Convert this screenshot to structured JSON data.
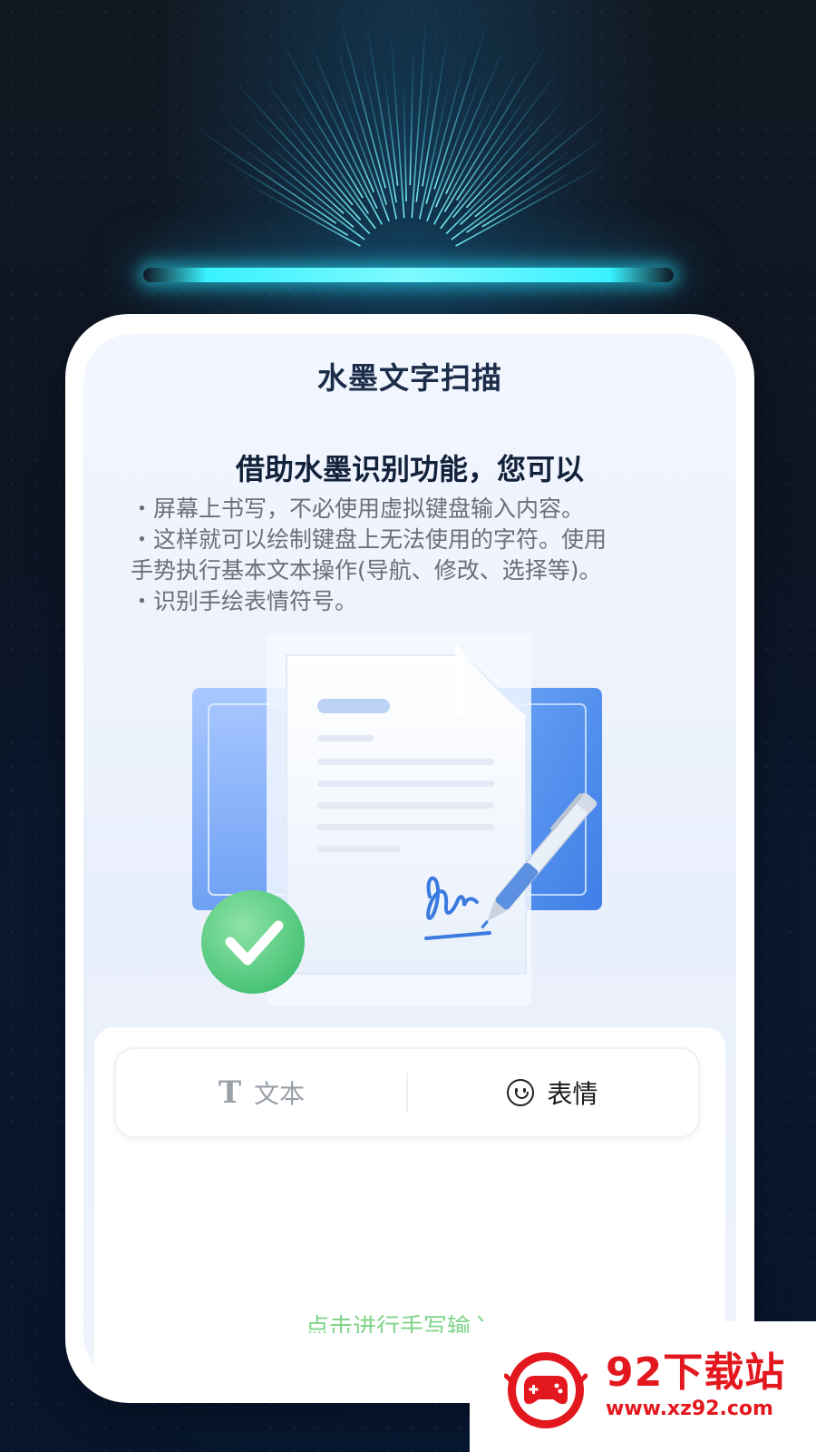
{
  "card": {
    "title": "水墨文字扫描",
    "subtitle": "借助水墨识别功能，您可以",
    "bullets": [
      "・屏幕上书写，不必使用虚拟键盘输入内容。",
      "・这样就可以绘制键盘上无法使用的字符。使用",
      "手势执行基本文本操作(导航、修改、选择等)。",
      "・识别手绘表情符号。"
    ]
  },
  "tabs": {
    "text_label": "文本",
    "text_icon": "T",
    "emoji_label": "表情"
  },
  "hint": "点击进行手写输入",
  "watermark": {
    "name": "92下载站",
    "url": "www.xz92.com"
  },
  "colors": {
    "glow": "#38f2ff",
    "card_bg": "#ffffff",
    "accent_green": "#5ccf86",
    "accent_blue": "#4f8de8",
    "watermark_red": "#e3181e"
  }
}
